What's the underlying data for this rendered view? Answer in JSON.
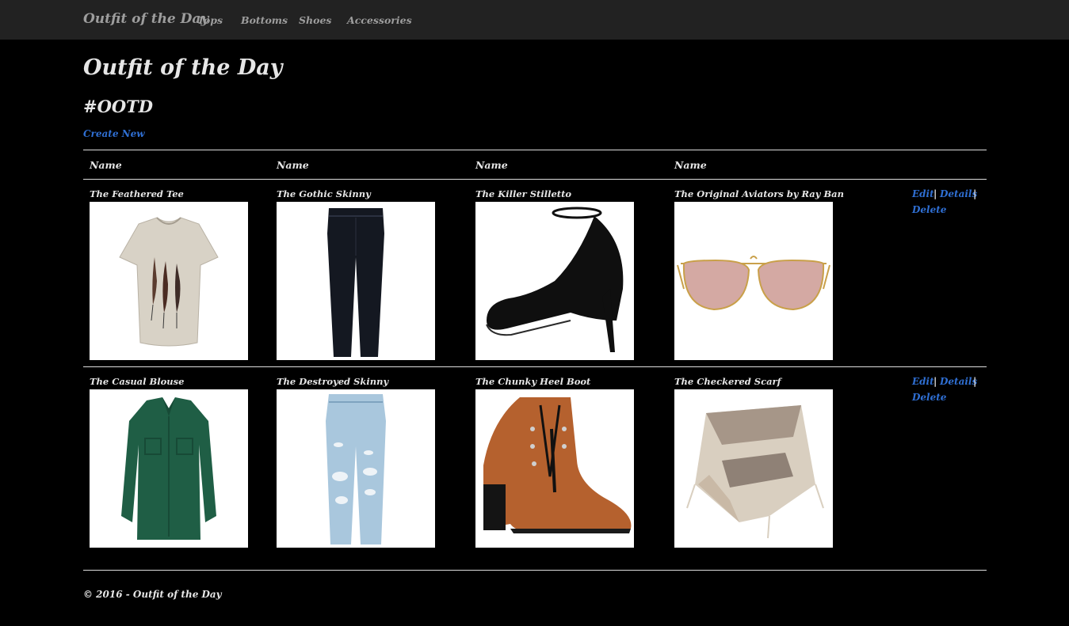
{
  "navbar": {
    "brand": "Outfit of the Day",
    "links": [
      "Tops",
      "Bottoms",
      "Shoes",
      "Accessories"
    ]
  },
  "page": {
    "title": "Outfit of the Day",
    "subtitle": "#OOTD",
    "create_new": "Create New"
  },
  "table": {
    "headers": [
      "Name",
      "Name",
      "Name",
      "Name"
    ],
    "rows": [
      {
        "items": [
          "The Feathered Tee",
          "The Gothic Skinny",
          "The Killer Stilletto",
          "The Original Aviators by Ray Ban"
        ],
        "icons": [
          "tshirt-image",
          "jeans-image",
          "stiletto-image",
          "aviator-sunglasses-image"
        ],
        "actions": {
          "edit": "Edit",
          "details": "Details",
          "delete": "Delete",
          "separator": "|"
        }
      },
      {
        "items": [
          "The Casual Blouse",
          "The Destroyed Skinny",
          "The Chunky Heel Boot",
          "The Checkered Scarf"
        ],
        "icons": [
          "blouse-image",
          "ripped-jeans-image",
          "boot-image",
          "scarf-image"
        ],
        "actions": {
          "edit": "Edit",
          "details": "Details",
          "delete": "Delete",
          "separator": "|"
        }
      }
    ]
  },
  "footer": {
    "text": "© 2016 - Outfit of the Day"
  },
  "colors": {
    "background": "#000000",
    "navbar": "#222222",
    "link": "#2f6fd3",
    "text": "#e6e6e6",
    "nav_text": "#9d9d9d"
  }
}
